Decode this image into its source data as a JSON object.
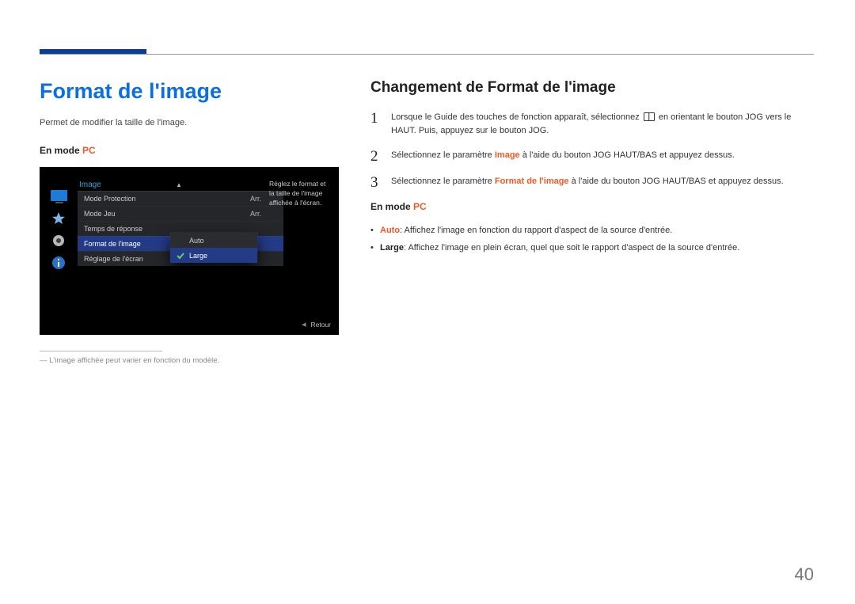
{
  "left": {
    "heading": "Format de l'image",
    "lead": "Permet de modifier la taille de l'image.",
    "mode_prefix": "En mode ",
    "mode_value": "PC",
    "osd": {
      "title": "Image",
      "rows": [
        {
          "label": "Mode Protection",
          "value": "Arr."
        },
        {
          "label": "Mode Jeu",
          "value": "Arr."
        },
        {
          "label": "Temps de réponse",
          "value": ""
        },
        {
          "label": "Format de l'image",
          "value": ""
        },
        {
          "label": "Réglage de l'écran",
          "value": ""
        }
      ],
      "popup": {
        "options": [
          "Auto",
          "Large"
        ],
        "selected": "Large"
      },
      "desc": "Réglez le format et la taille de l'image affichée à l'écran.",
      "return": "Retour"
    },
    "footnote": "L'image affichée peut varier en fonction du modèle."
  },
  "right": {
    "heading": "Changement de Format de l'image",
    "steps": [
      {
        "n": "1",
        "pre": "Lorsque le Guide des touches de fonction apparaît, sélectionnez ",
        "post": " en orientant le bouton JOG vers le HAUT. Puis, appuyez sur le bouton JOG."
      },
      {
        "n": "2",
        "pre": "Sélectionnez le paramètre ",
        "param": "Image",
        "post": " à l'aide du bouton JOG HAUT/BAS et appuyez dessus."
      },
      {
        "n": "3",
        "pre": "Sélectionnez le paramètre ",
        "param": "Format de l'image",
        "post": " à l'aide du bouton JOG HAUT/BAS et appuyez dessus."
      }
    ],
    "mode_prefix": "En mode ",
    "mode_value": "PC",
    "bullets": [
      {
        "opt": "Auto",
        "txt": ": Affichez l'image en fonction du rapport d'aspect de la source d'entrée."
      },
      {
        "opt": "Large",
        "txt": ": Affichez l'image en plein écran, quel que soit le rapport d'aspect de la source d'entrée."
      }
    ]
  },
  "page_number": "40"
}
